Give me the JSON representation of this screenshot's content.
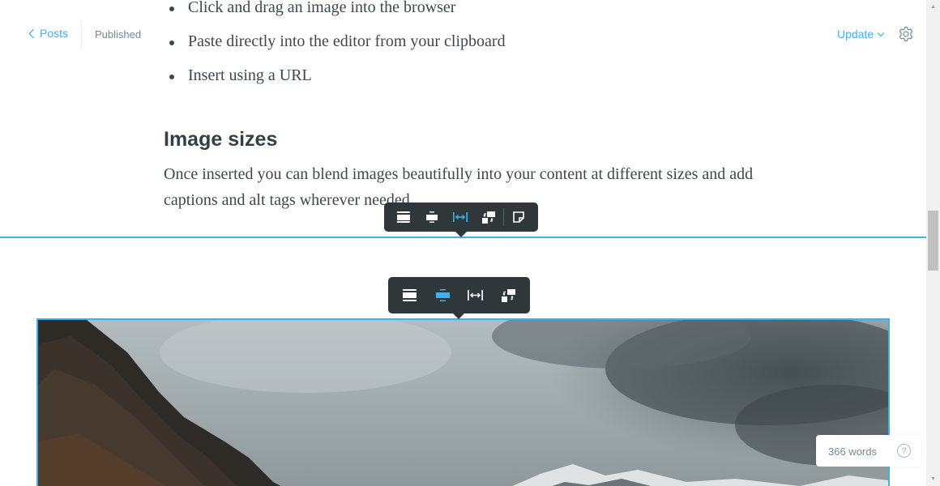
{
  "topbar": {
    "back_label": "Posts",
    "status": "Published",
    "update_label": "Update"
  },
  "content": {
    "bullets": [
      "Click and drag an image into the browser",
      "Paste directly into the editor from your clipboard",
      "Insert using a URL"
    ],
    "heading": "Image sizes",
    "paragraph": "Once inserted you can blend images beautifully into your content at different sizes and add captions and alt tags wherever needed."
  },
  "toolbar_a": {
    "buttons": [
      "image-width-regular-icon",
      "image-width-wide-icon",
      "image-width-full-icon",
      "replace-image-icon",
      "snippet-icon"
    ],
    "active": "image-width-full-icon"
  },
  "toolbar_b": {
    "buttons": [
      "image-width-regular-icon",
      "image-width-wide-icon",
      "image-width-full-icon",
      "replace-image-icon"
    ],
    "active": "image-width-wide-icon"
  },
  "footer": {
    "word_count": "366 words",
    "help_icon": "?"
  },
  "colors": {
    "accent": "#3eb0ef",
    "toolbar_bg": "#2f373b",
    "text": "#3d474d",
    "muted": "#738a94"
  }
}
